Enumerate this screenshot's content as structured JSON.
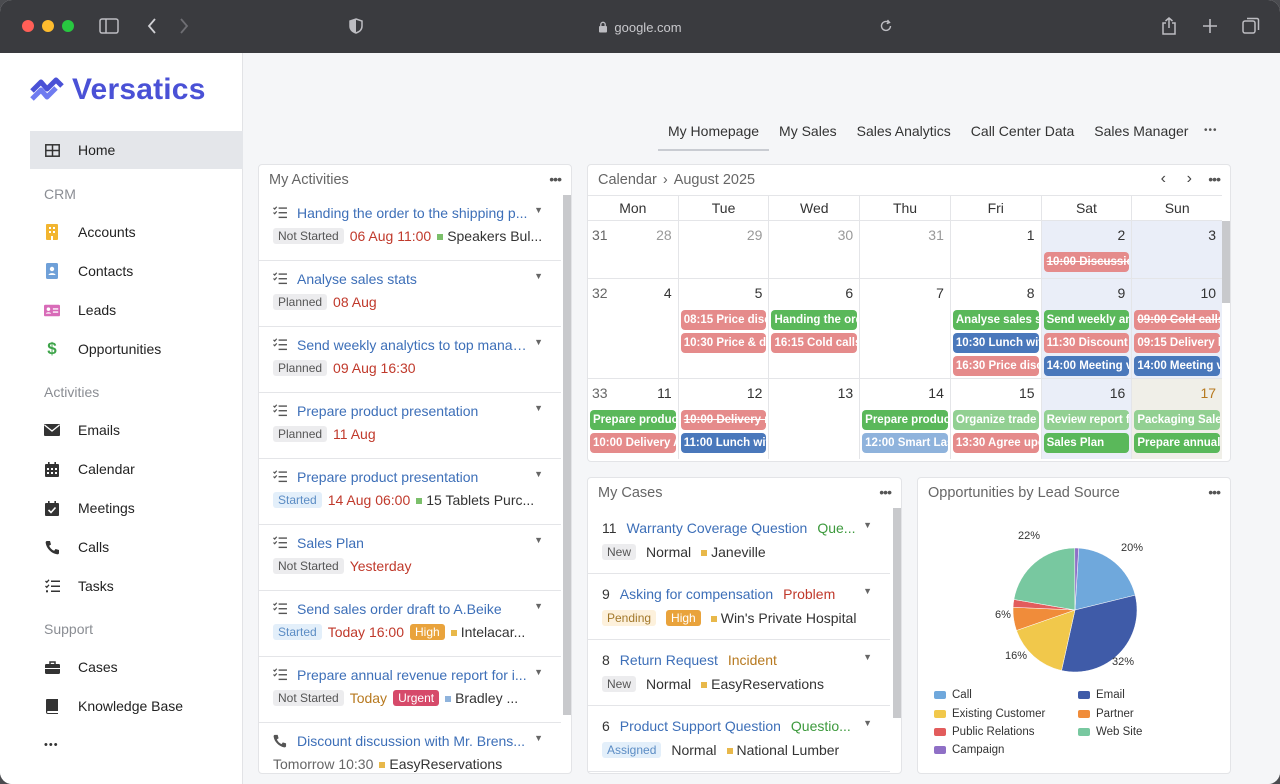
{
  "browser": {
    "url": "google.com"
  },
  "brand": {
    "name": "Versatics",
    "color": "#4a51d6"
  },
  "sidebar": {
    "home": "Home",
    "sections": {
      "crm": "CRM",
      "activities": "Activities",
      "support": "Support"
    },
    "crm_items": [
      "Accounts",
      "Contacts",
      "Leads",
      "Opportunities"
    ],
    "activity_items": [
      "Emails",
      "Calendar",
      "Meetings",
      "Calls",
      "Tasks"
    ],
    "support_items": [
      "Cases",
      "Knowledge Base"
    ],
    "more": "•••"
  },
  "tabs": [
    "My Homepage",
    "My Sales",
    "Sales Analytics",
    "Call Center Data",
    "Sales Manager"
  ],
  "tabs_more": "•••",
  "activities": {
    "title": "My Activities",
    "items": [
      {
        "title": "Handing the order to the shipping p...",
        "status": "Not Started",
        "date": "06 Aug 11:00",
        "related": "Speakers Bul...",
        "rel_color": "#7bbf6a"
      },
      {
        "title": "Analyse sales stats",
        "status": "Planned",
        "date": "08 Aug"
      },
      {
        "title": "Send weekly analytics to top manag...",
        "status": "Planned",
        "date": "09 Aug 16:30"
      },
      {
        "title": "Prepare product presentation",
        "status": "Planned",
        "date": "11 Aug"
      },
      {
        "title": "Prepare product presentation",
        "status": "Started",
        "date": "14 Aug 06:00",
        "related": "15 Tablets Purc...",
        "rel_color": "#7bbf6a"
      },
      {
        "title": "Sales Plan",
        "status": "Not Started",
        "date": "Yesterday"
      },
      {
        "title": "Send sales order draft to A.Beike",
        "status": "Started",
        "date": "Today 16:00",
        "priority": "High",
        "related": "Intelacar...",
        "rel_color": "#e8b84a"
      },
      {
        "title": "Prepare annual revenue report for i...",
        "status": "Not Started",
        "date": "Today",
        "priority": "Urgent",
        "related": "Bradley ...",
        "rel_color": "#8fb3dc"
      },
      {
        "title": "Discount discussion with Mr. Brens...",
        "date": "Tomorrow 10:30",
        "related": "EasyReservations",
        "rel_color": "#e8b84a"
      }
    ]
  },
  "calendar": {
    "title": "Calendar",
    "month": "August 2025",
    "days": [
      "Mon",
      "Tue",
      "Wed",
      "Thu",
      "Fri",
      "Sat",
      "Sun"
    ],
    "weeks": [
      {
        "num": "31",
        "dates": [
          "28",
          "29",
          "30",
          "31",
          "1",
          "2",
          "3"
        ]
      },
      {
        "num": "32",
        "dates": [
          "4",
          "5",
          "6",
          "7",
          "8",
          "9",
          "10"
        ]
      },
      {
        "num": "33",
        "dates": [
          "11",
          "12",
          "13",
          "14",
          "15",
          "16",
          "17"
        ]
      }
    ],
    "events": {
      "w1_sat": "10:00 Discussio",
      "w2_tue_1": "08:15 Price disc",
      "w2_tue_2": "10:30 Price & de",
      "w2_wed_1": "Handing the ord",
      "w2_wed_2": "16:15 Cold calls",
      "w2_fri_1": "Analyse sales st",
      "w2_fri_2": "10:30 Lunch wit",
      "w2_fri_3": "16:30 Price disc",
      "w2_sat_1": "Send weekly an",
      "w2_sat_2": "11:30 Discount r",
      "w2_sat_3": "14:00 Meeting v",
      "w2_sun_1": "09:00 Cold calls",
      "w2_sun_2": "09:15 Delivery l",
      "w2_sun_3": "14:00 Meeting v",
      "w3_mon_1": "Prepare product",
      "w3_mon_2": "10:00 Delivery A",
      "w3_tue_1": "10:00 Delivery r",
      "w3_tue_2": "11:00 Lunch wit",
      "w3_thu_1": "Prepare product",
      "w3_thu_2": "12:00 Smart Las",
      "w3_fri_1": "Organize trade s",
      "w3_fri_2": "13:30 Agree upc",
      "w3_sat_1": "Review report fo",
      "w3_sat_2": "Sales Plan",
      "w3_sun_1": "Packaging Sales",
      "w3_sun_2": "Prepare annual"
    }
  },
  "cases": {
    "title": "My Cases",
    "items": [
      {
        "num": "11",
        "title": "Warranty Coverage Question",
        "type": "Que...",
        "type_color": "#3d9a3d",
        "status": "New",
        "priority": "Normal",
        "account": "Janeville"
      },
      {
        "num": "9",
        "title": "Asking for compensation",
        "type": "Problem",
        "type_color": "#c0392b",
        "status": "Pending",
        "priority": "High",
        "account": "Win's Private Hospital"
      },
      {
        "num": "8",
        "title": "Return Request",
        "type": "Incident",
        "type_color": "#b7791f",
        "status": "New",
        "priority": "Normal",
        "account": "EasyReservations"
      },
      {
        "num": "6",
        "title": "Product Support Question",
        "type": "Questio...",
        "type_color": "#3d9a3d",
        "status": "Assigned",
        "priority": "Normal",
        "account": "National Lumber"
      }
    ]
  },
  "opportunities": {
    "title": "Opportunities by Lead Source",
    "labels": {
      "p22": "22%",
      "p20": "20%",
      "p6": "6%",
      "p16": "16%",
      "p32": "32%"
    },
    "legend": [
      {
        "name": "Call",
        "color": "#6fa8dc"
      },
      {
        "name": "Email",
        "color": "#3f5ba8"
      },
      {
        "name": "Existing Customer",
        "color": "#f1c84b"
      },
      {
        "name": "Partner",
        "color": "#f08c3a"
      },
      {
        "name": "Public Relations",
        "color": "#e25c5c"
      },
      {
        "name": "Web Site",
        "color": "#78c8a0"
      },
      {
        "name": "Campaign",
        "color": "#8f6fc6"
      }
    ]
  },
  "chart_data": {
    "type": "pie",
    "title": "Opportunities by Lead Source",
    "categories": [
      "Call",
      "Email",
      "Existing Customer",
      "Partner",
      "Public Relations",
      "Web Site",
      "Campaign"
    ],
    "values": [
      20,
      32,
      16,
      6,
      2,
      22,
      1
    ],
    "legend": "bottom"
  }
}
